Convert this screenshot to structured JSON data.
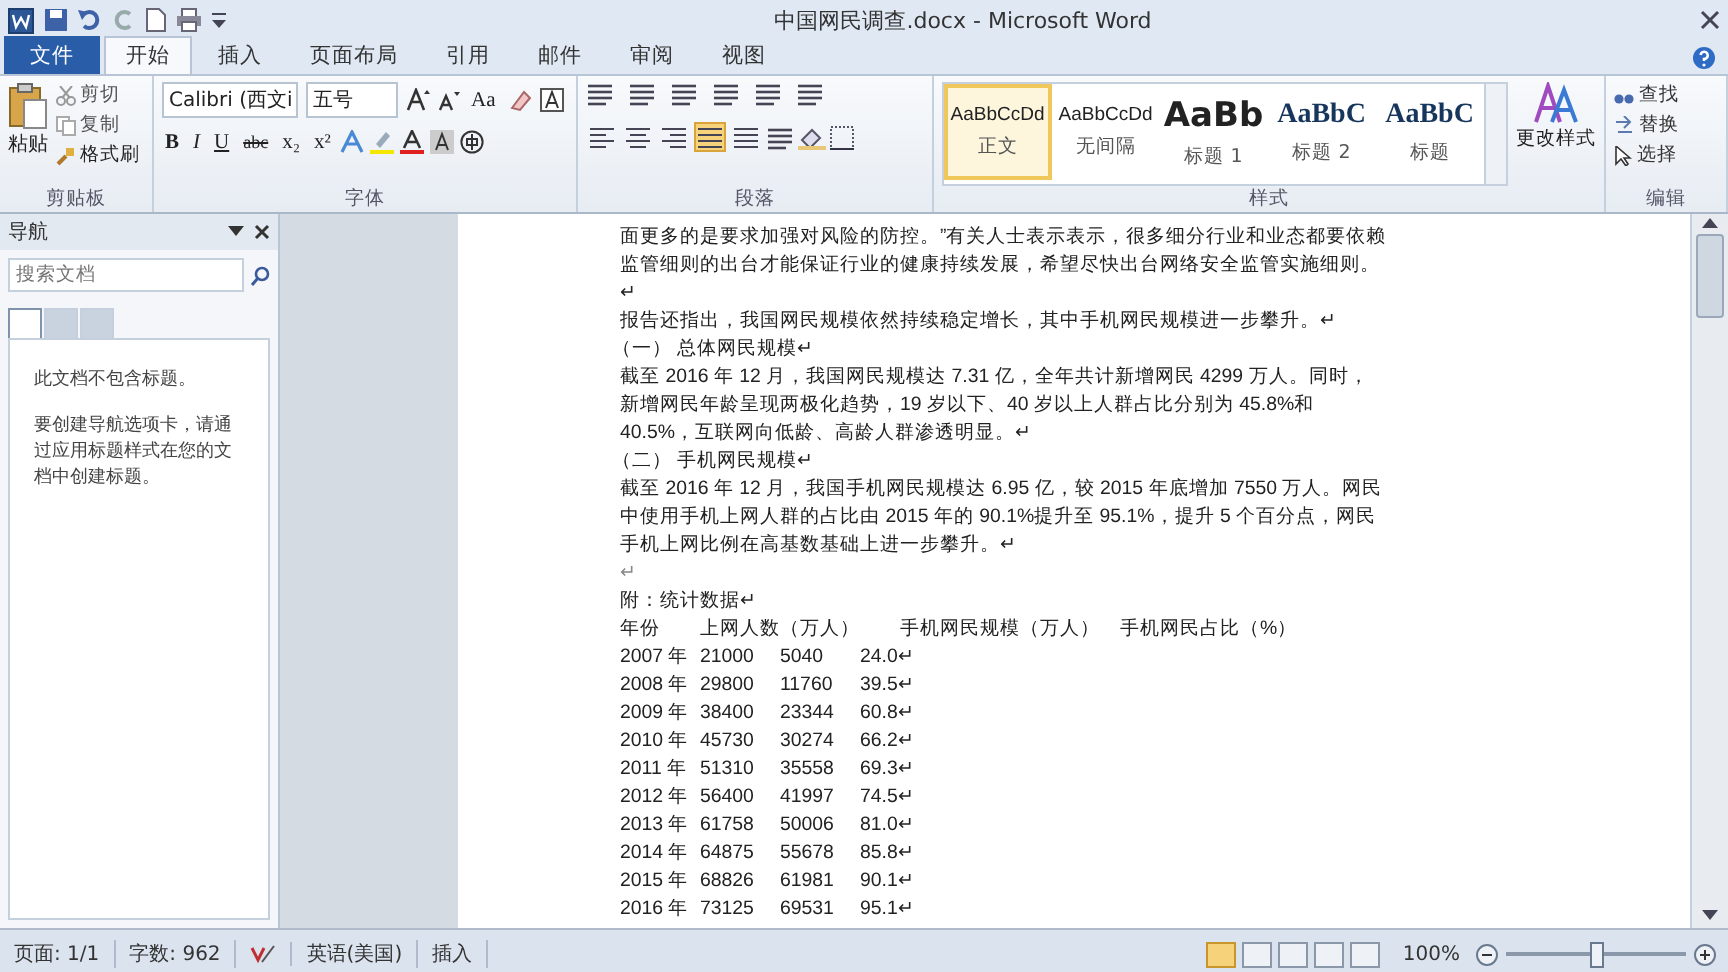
{
  "window": {
    "title": "中国网民调查.docx - Microsoft Word"
  },
  "tabs": [
    {
      "label": "文件",
      "kind": "file",
      "selected": false
    },
    {
      "label": "开始",
      "kind": "tab",
      "selected": true
    },
    {
      "label": "插入",
      "kind": "tab",
      "selected": false
    },
    {
      "label": "页面布局",
      "kind": "tab",
      "selected": false
    },
    {
      "label": "引用",
      "kind": "tab",
      "selected": false
    },
    {
      "label": "邮件",
      "kind": "tab",
      "selected": false
    },
    {
      "label": "审阅",
      "kind": "tab",
      "selected": false
    },
    {
      "label": "视图",
      "kind": "tab",
      "selected": false
    }
  ],
  "clipboard": {
    "paste": "粘贴",
    "cut": "剪切",
    "copy": "复制",
    "format_painter": "格式刷",
    "label": "剪贴板"
  },
  "font": {
    "font_name": "Calibri (西文i",
    "font_size": "五号",
    "change_case": "Aa",
    "format_buttons": [
      "B",
      "I",
      "U",
      "abc",
      "x₂",
      "x²"
    ],
    "label": "字体"
  },
  "paragraph": {
    "alignments": [
      {
        "selected": false
      },
      {
        "selected": false
      },
      {
        "selected": false
      },
      {
        "selected": true
      },
      {
        "selected": false
      }
    ],
    "label": "段落"
  },
  "styles": {
    "items": [
      {
        "preview": "AaBbCcDd",
        "name": "正文",
        "kind": "normal",
        "selected": true
      },
      {
        "preview": "AaBbCcDd",
        "name": "无间隔",
        "kind": "normal",
        "selected": false
      },
      {
        "preview": "AaBb",
        "name": "标题 1",
        "kind": "heading1",
        "selected": false
      },
      {
        "preview": "AaBbC",
        "name": "标题 2",
        "kind": "heading2",
        "selected": false
      },
      {
        "preview": "AaBbC",
        "name": "标题",
        "kind": "title",
        "selected": false
      }
    ],
    "change_styles": "更改样式",
    "label": "样式"
  },
  "editing": {
    "find": "查找",
    "replace": "替换",
    "select": "选择",
    "label": "编辑"
  },
  "nav_pane": {
    "title": "导航",
    "search_placeholder": "搜索文档",
    "views": [
      {
        "selected": true
      },
      {
        "selected": false
      },
      {
        "selected": false
      }
    ],
    "message": "此文档不包含标题。",
    "hint": "要创建导航选项卡，请通过应用标题样式在您的文档中创建标题。"
  },
  "document": {
    "paragraphs": [
      {
        "kind": "body",
        "text": "面更多的是要求加强对风险的防控。”有关人士表示表示，很多细分行业和业态都要依赖监管细则的出台才能保证行业的健康持续发展，希望尽快出台网络安全监管实施细则。↵"
      },
      {
        "kind": "body",
        "text": "报告还指出，我国网民规模依然持续稳定增长，其中手机网民规模进一步攀升。↵"
      },
      {
        "kind": "heading",
        "text": "（一） 总体网民规模↵"
      },
      {
        "kind": "body",
        "text": "截至 2016 年 12 月，我国网民规模达 7.31 亿，全年共计新增网民 4299 万人。同时，新增网民年龄呈现两极化趋势，19 岁以下、40 岁以上人群占比分别为 45.8%和 40.5%，互联网向低龄、高龄人群渗透明显。↵"
      },
      {
        "kind": "heading",
        "text": "（二） 手机网民规模↵"
      },
      {
        "kind": "body",
        "text": "截至 2016 年 12 月，我国手机网民规模达 6.95 亿，较 2015 年底增加 7550 万人。网民中使用手机上网人群的占比由 2015 年的 90.1%提升至 95.1%，提升 5 个百分点，网民手机上网比例在高基数基础上进一步攀升。↵"
      },
      {
        "kind": "blank",
        "text": "↵"
      },
      {
        "kind": "body",
        "text": "附：统计数据↵"
      }
    ],
    "table": {
      "header": [
        "年份",
        "上网人数（万人）",
        "手机网民规模（万人）",
        "手机网民占比（%）"
      ],
      "rows": [
        [
          "2007 年",
          "21000",
          "5040",
          "24.0↵"
        ],
        [
          "2008 年",
          "29800",
          "11760",
          "39.5↵"
        ],
        [
          "2009 年",
          "38400",
          "23344",
          "60.8↵"
        ],
        [
          "2010 年",
          "45730",
          "30274",
          "66.2↵"
        ],
        [
          "2011 年",
          "51310",
          "35558",
          "69.3↵"
        ],
        [
          "2012 年",
          "56400",
          "41997",
          "74.5↵"
        ],
        [
          "2013 年",
          "61758",
          "50006",
          "81.0↵"
        ],
        [
          "2014 年",
          "64875",
          "55678",
          "85.8↵"
        ],
        [
          "2015 年",
          "68826",
          "61981",
          "90.1↵"
        ],
        [
          "2016 年",
          "73125",
          "69531",
          "95.1↵"
        ]
      ]
    }
  },
  "status_bar": {
    "page": "页面: 1/1",
    "words": "字数: 962",
    "language": "英语(美国)",
    "mode": "插入",
    "views": [
      {
        "selected": true
      },
      {
        "selected": false
      },
      {
        "selected": false
      },
      {
        "selected": false
      },
      {
        "selected": false
      }
    ],
    "zoom": "100%",
    "zoom_slider": {
      "level": 0.5
    }
  }
}
